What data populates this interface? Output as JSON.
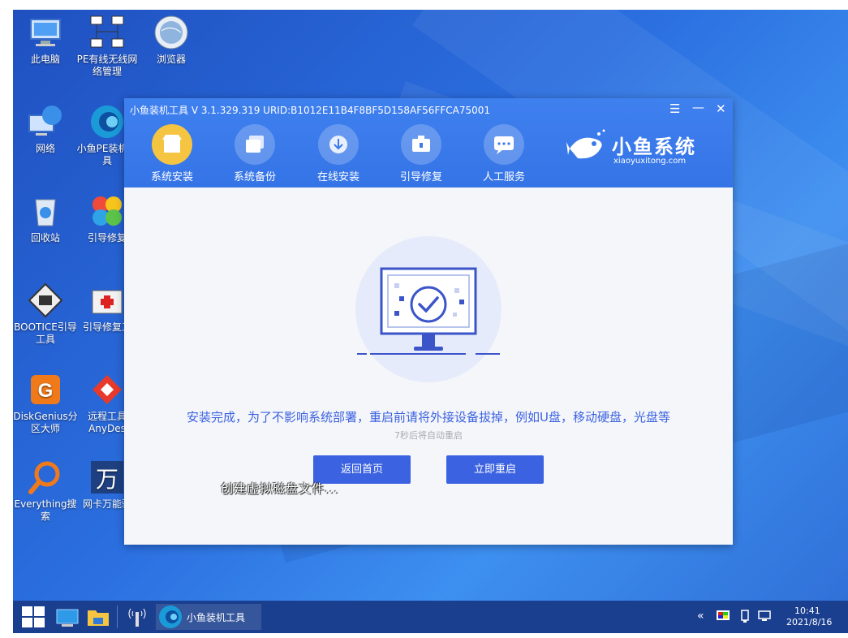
{
  "desktop_icons": [
    {
      "label": "此电脑",
      "icon": "computer-icon"
    },
    {
      "label": "PE有线无线网络管理",
      "icon": "network-manager-icon"
    },
    {
      "label": "浏览器",
      "icon": "browser-globe-icon"
    },
    {
      "label": "网络",
      "icon": "network-icon"
    },
    {
      "label": "小鱼PE装机工具",
      "icon": "xiaoyu-tool-icon"
    },
    {
      "label": "回收站",
      "icon": "recycle-bin-icon"
    },
    {
      "label": "引导修复",
      "icon": "boot-repair-icon"
    },
    {
      "label": "BOOTICE引导工具",
      "icon": "bootice-icon"
    },
    {
      "label": "引导修复工",
      "icon": "boot-repair-tool-icon"
    },
    {
      "label": "DiskGenius分区大师",
      "icon": "diskgenius-icon"
    },
    {
      "label": "远程工具AnyDes",
      "icon": "anydesk-icon"
    },
    {
      "label": "Everything搜索",
      "icon": "everything-search-icon"
    },
    {
      "label": "网卡万能驱",
      "icon": "nic-driver-icon"
    }
  ],
  "window": {
    "title": "小鱼装机工具 V 3.1.329.319 URID:B1012E11B4F8BF5D158AF56FFCA75001",
    "tabs": [
      {
        "label": "系统安装",
        "icon": "system-install-icon"
      },
      {
        "label": "系统备份",
        "icon": "system-backup-icon"
      },
      {
        "label": "在线安装",
        "icon": "online-install-icon"
      },
      {
        "label": "引导修复",
        "icon": "boot-repair-icon"
      },
      {
        "label": "人工服务",
        "icon": "chat-service-icon"
      }
    ],
    "brand_name": "小鱼系统",
    "brand_url": "xiaoyuxitong.com",
    "message": "安装完成，为了不影响系统部署，重启前请将外接设备拔掉，例如U盘，移动硬盘，光盘等",
    "countdown": "7秒后将自动重启",
    "btn_home": "返回首页",
    "btn_restart": "立即重启"
  },
  "ghost_text": "创建虚拟磁盘文件...",
  "taskbar": {
    "app_label": "小鱼装机工具",
    "time": "10:41",
    "date": "2021/8/16"
  },
  "colors": {
    "accent": "#3b62e0",
    "header": "#3a7aeb",
    "active_tab": "#f5c542"
  }
}
